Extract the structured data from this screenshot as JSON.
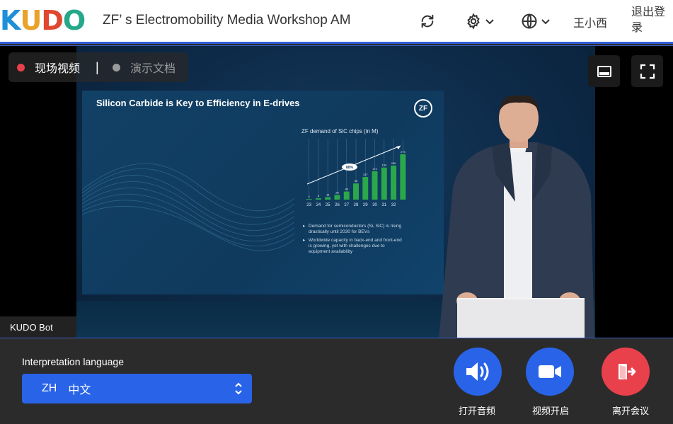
{
  "header": {
    "logo_letters": [
      "K",
      "U",
      "D",
      "O"
    ],
    "logo_colors": [
      "#1f8fd8",
      "#e9a22a",
      "#e0472f",
      "#25a78a"
    ],
    "title": "ZF’ s Electromobility Media Workshop AM",
    "user_name": "王小西",
    "logout_label": "退出登录",
    "icons": [
      "refresh-icon",
      "gear-icon",
      "globe-icon"
    ]
  },
  "video": {
    "tabs": [
      {
        "label": "现场视频",
        "active": true
      },
      {
        "label": "演示文档",
        "active": false
      }
    ],
    "tab_separator": "|",
    "bot_label": "KUDO Bot",
    "buttons": [
      "subtitle-icon",
      "fullscreen-icon"
    ]
  },
  "slide": {
    "title": "Silicon Carbide is Key to Efficiency in E-drives",
    "logo_text": "ZF",
    "bullets": [
      "Demand for semiconductors (Si, SiC) is rising drastically until 2030 for BEVs",
      "Worldwide capacity in back-end and front-end is growing, yet with challenges due to equipment availability"
    ]
  },
  "chart_data": {
    "type": "bar",
    "title": "ZF demand of SiC chips (in M)",
    "categories": [
      "23",
      "24",
      "25",
      "26",
      "27",
      "28",
      "29",
      "30",
      "31",
      "32"
    ],
    "values": [
      4,
      8,
      15,
      28,
      49,
      98,
      137,
      172,
      194,
      206,
      275
    ],
    "labels": [
      "4",
      "8",
      "15",
      "28",
      "49",
      "98",
      "137",
      "172",
      "194",
      "206",
      "275"
    ],
    "cagr_label": "80%",
    "bar_color": "#2aa84a",
    "xlabel": "",
    "ylabel": ""
  },
  "bottom": {
    "lang_label": "Interpretation language",
    "lang_code": "ZH",
    "lang_name": "中文",
    "controls": [
      {
        "label": "打开音频",
        "icon": "speaker-icon",
        "color": "#2964e8"
      },
      {
        "label": "视频开启",
        "icon": "camera-icon",
        "color": "#2964e8"
      },
      {
        "label": "离开会议",
        "icon": "leave-icon",
        "color": "#e8414c"
      }
    ]
  }
}
